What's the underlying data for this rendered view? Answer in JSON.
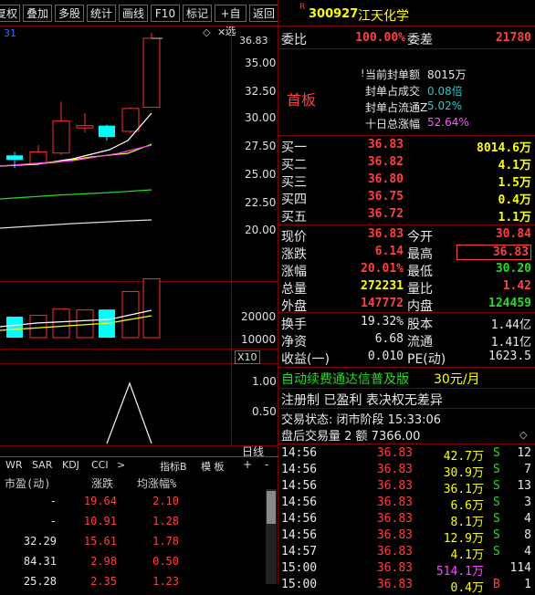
{
  "toolbar": {
    "buttons": [
      "复权",
      "叠加",
      "多股",
      "统计",
      "画线",
      "F10",
      "标记",
      "+自选",
      "返回"
    ]
  },
  "stock": {
    "flag": "R",
    "code": "300927",
    "name": "江天化学"
  },
  "chart": {
    "corner_label": "31",
    "last_price_label": "36.83",
    "price_ticks": [
      "35.00",
      "32.50",
      "30.00",
      "27.50",
      "25.00",
      "22.50",
      "20.00"
    ],
    "volume_ticks": [
      "20000",
      "10000"
    ],
    "volume_unit": "X10",
    "indicator_ticks": [
      "1.00",
      "0.50"
    ],
    "indicator_tabs": [
      "WR",
      "SAR",
      "KDJ",
      "CCI",
      ">"
    ],
    "indicator_b": "指标B",
    "template_label": "模 板",
    "plus": "+",
    "minus": "-",
    "day_line": "日线"
  },
  "chart_data": {
    "type": "candlestick",
    "candles": [
      {
        "open": 26.2,
        "high": 26.9,
        "low": 25.5,
        "close": 26.6,
        "color": "cyan"
      },
      {
        "open": 25.9,
        "high": 27.5,
        "low": 25.7,
        "close": 26.9,
        "color": "red"
      },
      {
        "open": 26.8,
        "high": 31.3,
        "low": 26.6,
        "close": 29.6,
        "color": "red"
      },
      {
        "open": 29.0,
        "high": 30.3,
        "low": 28.6,
        "close": 29.2,
        "color": "red"
      },
      {
        "open": 29.2,
        "high": 29.3,
        "low": 27.9,
        "close": 28.2,
        "color": "cyan"
      },
      {
        "open": 28.7,
        "high": 30.8,
        "low": 28.5,
        "close": 30.7,
        "color": "red"
      },
      {
        "open": 30.8,
        "high": 37.3,
        "low": 30.8,
        "close": 36.83,
        "color": "red"
      }
    ],
    "volumes": [
      5000,
      5300,
      6800,
      6600,
      6700,
      11000,
      14000
    ],
    "ylim": [
      19,
      38
    ]
  },
  "pe_table": {
    "headers": [
      "市盈(动)",
      "涨跌",
      "均涨幅%"
    ],
    "rows": [
      [
        "-",
        "19.64",
        "2.10"
      ],
      [
        "-",
        "10.91",
        "1.28"
      ],
      [
        "32.29",
        "15.61",
        "1.78"
      ],
      [
        "84.31",
        "2.98",
        "0.50"
      ],
      [
        "25.28",
        "2.35",
        "1.23"
      ]
    ]
  },
  "quote": {
    "weibi_label": "委比",
    "weibi_value": "100.00%",
    "weicha_label": "委差",
    "weicha_value": "21780",
    "limit_label": "首板",
    "seal_info": [
      {
        "label": "当前封单额",
        "value": "8015万",
        "color": "white"
      },
      {
        "label": "封单占成交",
        "value": "0.08倍",
        "color": "cyan"
      },
      {
        "label": "封单占流通Z",
        "value": "5.02%",
        "color": "cyan"
      },
      {
        "label": "十日总涨幅",
        "value": "52.64%",
        "color": "mag"
      }
    ],
    "buy": [
      {
        "label": "买一",
        "price": "36.83",
        "vol": "8014.6万"
      },
      {
        "label": "买二",
        "price": "36.82",
        "vol": "4.1万"
      },
      {
        "label": "买三",
        "price": "36.80",
        "vol": "1.5万"
      },
      {
        "label": "买四",
        "price": "36.75",
        "vol": "0.4万"
      },
      {
        "label": "买五",
        "price": "36.72",
        "vol": "1.1万"
      }
    ],
    "stats_left": [
      {
        "label": "现价",
        "value": "36.83",
        "color": "red"
      },
      {
        "label": "涨跌",
        "value": "6.14",
        "color": "red"
      },
      {
        "label": "涨幅",
        "value": "20.01%",
        "color": "red"
      },
      {
        "label": "总量",
        "value": "272231",
        "color": "yellow"
      },
      {
        "label": "外盘",
        "value": "147772",
        "color": "red"
      }
    ],
    "stats_right": [
      {
        "label": "今开",
        "value": "30.84",
        "color": "red"
      },
      {
        "label": "最高",
        "value": "36.83",
        "color": "red"
      },
      {
        "label": "最低",
        "value": "30.20",
        "color": "green"
      },
      {
        "label": "量比",
        "value": "1.42",
        "color": "red"
      },
      {
        "label": "内盘",
        "value": "124459",
        "color": "green"
      }
    ],
    "fund_left": [
      {
        "label": "换手",
        "value": "19.32%"
      },
      {
        "label": "净资",
        "value": "6.68"
      },
      {
        "label": "收益(一)",
        "value": "0.010"
      }
    ],
    "fund_right": [
      {
        "label": "股本",
        "value": "1.44亿"
      },
      {
        "label": "流通",
        "value": "1.41亿"
      },
      {
        "label": "PE(动)",
        "value": "1623.5"
      }
    ],
    "promo": "自动续费通达信普及版",
    "promo_price": "30元/月",
    "notice": "注册制 已盈利 表决权无差异",
    "phase": "交易状态: 闭市阶段 15:33:06",
    "after_hours": "盘后交易量 2 额 7366.00"
  },
  "ticks": [
    {
      "time": "14:56",
      "price": "36.83",
      "vol": "42.7万",
      "side": "S",
      "num": "12"
    },
    {
      "time": "14:56",
      "price": "36.83",
      "vol": "30.9万",
      "side": "S",
      "num": "7"
    },
    {
      "time": "14:56",
      "price": "36.83",
      "vol": "36.1万",
      "side": "S",
      "num": "13"
    },
    {
      "time": "14:56",
      "price": "36.83",
      "vol": "6.6万",
      "side": "S",
      "num": "3"
    },
    {
      "time": "14:56",
      "price": "36.83",
      "vol": "8.1万",
      "side": "S",
      "num": "4"
    },
    {
      "time": "14:56",
      "price": "36.83",
      "vol": "12.9万",
      "side": "S",
      "num": "8"
    },
    {
      "time": "14:57",
      "price": "36.83",
      "vol": "4.1万",
      "side": "S",
      "num": "4"
    },
    {
      "time": "15:00",
      "price": "36.83",
      "vol": "514.1万",
      "side": "",
      "num": "114"
    },
    {
      "time": "15:00",
      "price": "36.83",
      "vol": "0.4万",
      "side": "B",
      "num": "1"
    }
  ],
  "colors": {
    "bg": "#000000",
    "up": "#ff3030",
    "down": "#00ffff",
    "grid": "#7a0000"
  }
}
